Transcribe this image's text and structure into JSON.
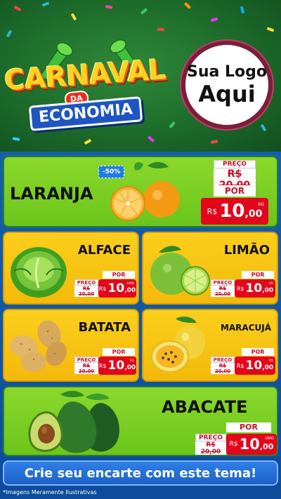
{
  "header": {
    "logo": {
      "word1": "CARNAVAL",
      "word2": "DA",
      "word3": "ECONOMIA"
    },
    "client_logo": {
      "line1": "Sua Logo",
      "line2": "Aqui"
    }
  },
  "currency": "R$",
  "products": [
    {
      "id": "laranja",
      "name": "LARANJA",
      "discount": "-50%",
      "preco_label": "PREÇO",
      "old_price": "R$ 20,00",
      "por_label": "POR",
      "price_int": "10",
      "price_dec": ",00",
      "unit": "KG"
    },
    {
      "id": "alface",
      "name": "ALFACE",
      "preco_label": "PREÇO",
      "old_price": "R$ 20,00",
      "por_label": "POR",
      "price_int": "10",
      "price_dec": ",00",
      "unit": "UNID"
    },
    {
      "id": "limao",
      "name": "LIMÃO",
      "preco_label": "PREÇO",
      "old_price": "R$ 20,00",
      "por_label": "POR",
      "price_int": "10",
      "price_dec": ",00",
      "unit": "KG"
    },
    {
      "id": "batata",
      "name": "BATATA",
      "preco_label": "PREÇO",
      "old_price": "R$ 20,00",
      "por_label": "POR",
      "price_int": "10",
      "price_dec": ",00",
      "unit": "KG"
    },
    {
      "id": "maracuja",
      "name": "MARACUJÁ",
      "preco_label": "PREÇO",
      "old_price": "R$ 20,00",
      "por_label": "POR",
      "price_int": "10",
      "price_dec": ",00",
      "unit": "KG"
    },
    {
      "id": "abacate",
      "name": "ABACATE",
      "preco_label": "PREÇO",
      "old_price": "R$ 20,00",
      "por_label": "POR",
      "price_int": "10",
      "price_dec": ",00",
      "unit": "UNID"
    }
  ],
  "cta": "Crie seu encarte com este tema!",
  "disclaimer": "*Imagens Meramente Ilustrativas",
  "colors": {
    "header_bg": "#1d6b2b",
    "page_bg": "#1560a8",
    "green_card": "#7ed321",
    "yellow_card": "#f8c512",
    "price_red": "#e3061b",
    "cta_blue": "#2f7fe6"
  }
}
